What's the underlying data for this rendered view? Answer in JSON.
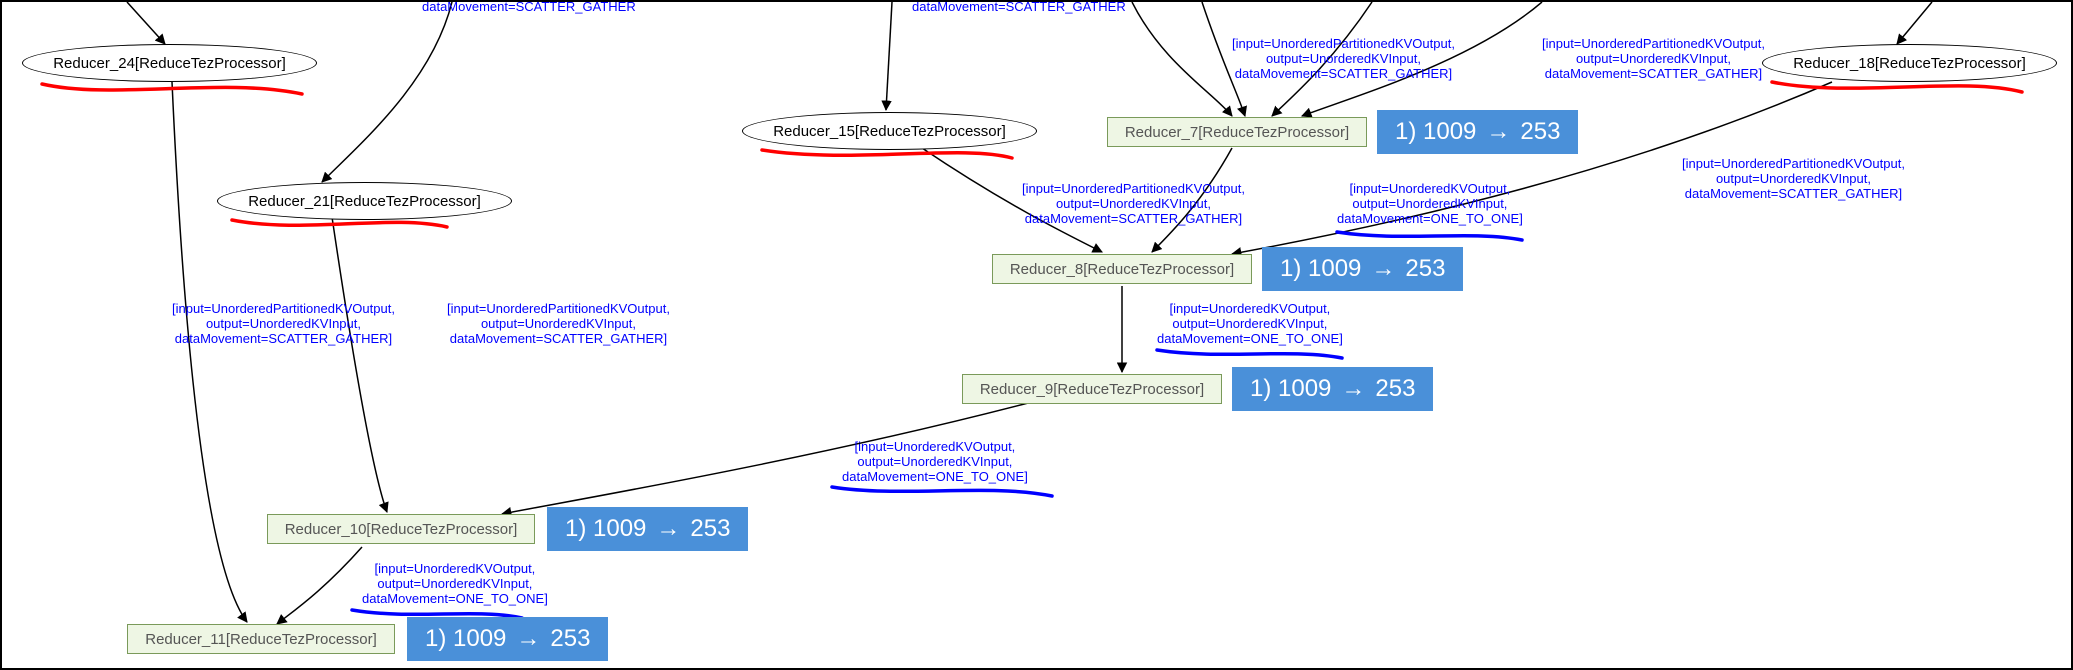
{
  "nodes": {
    "reducer24": "Reducer_24[ReduceTezProcessor]",
    "reducer21": "Reducer_21[ReduceTezProcessor]",
    "reducer15": "Reducer_15[ReduceTezProcessor]",
    "reducer18": "Reducer_18[ReduceTezProcessor]",
    "reducer7": "Reducer_7[ReduceTezProcessor]",
    "reducer8": "Reducer_8[ReduceTezProcessor]",
    "reducer9": "Reducer_9[ReduceTezProcessor]",
    "reducer10": "Reducer_10[ReduceTezProcessor]",
    "reducer11": "Reducer_11[ReduceTezProcessor]"
  },
  "edge_labels": {
    "scatter_gather_partitioned": "[input=UnorderedPartitionedKVOutput,\noutput=UnorderedKVInput,\ndataMovement=SCATTER_GATHER]",
    "cut_top_sg": "dataMovement=SCATTER_GATHER",
    "one_to_one": "[input=UnorderedKVOutput,\noutput=UnorderedKVInput,\ndataMovement=ONE_TO_ONE]"
  },
  "annotations": {
    "text_before": "1) 1009",
    "text_after": "253"
  }
}
